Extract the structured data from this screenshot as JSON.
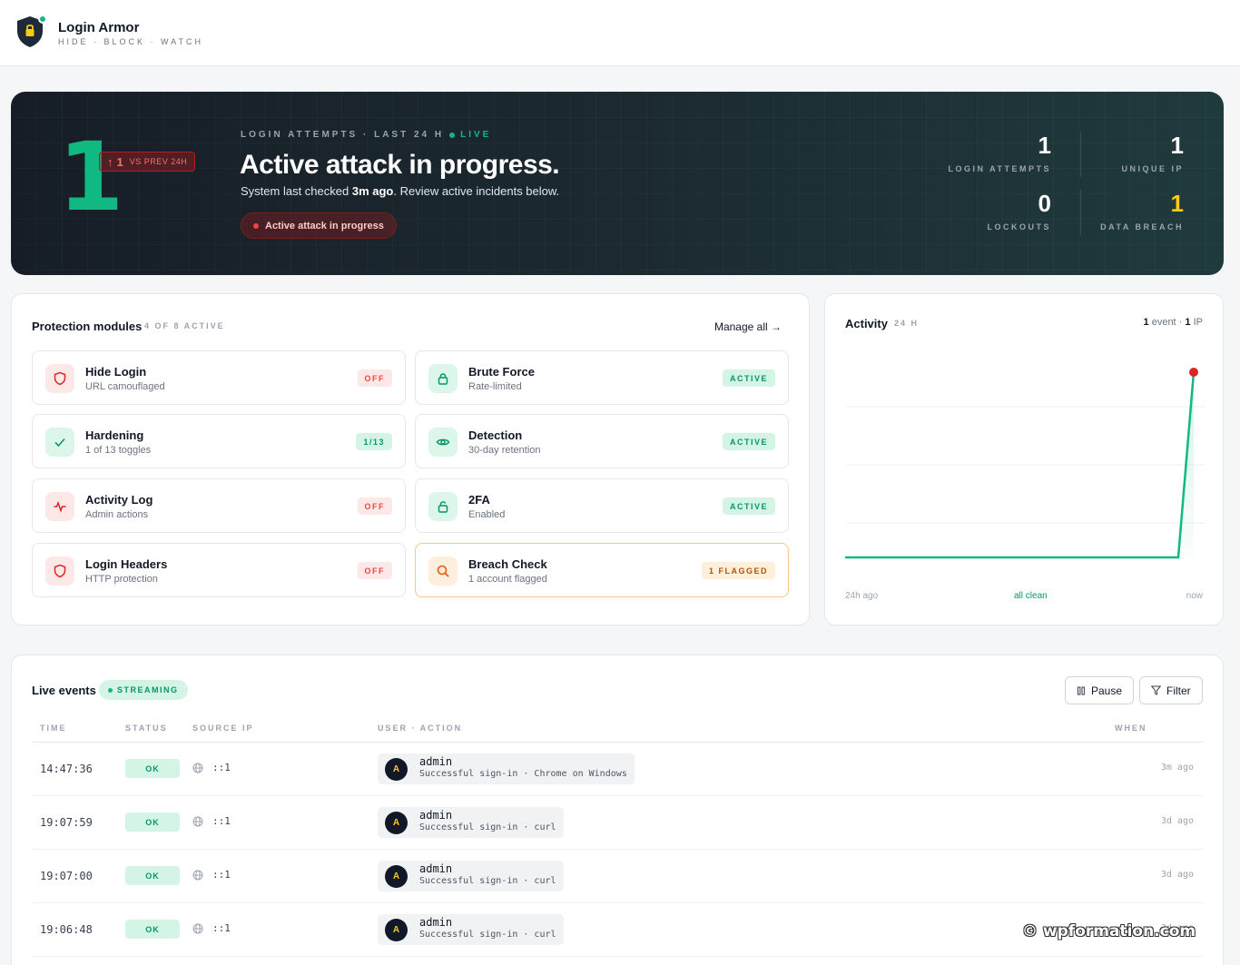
{
  "brand": {
    "name": "Login Armor",
    "tagline": "HIDE · BLOCK · WATCH"
  },
  "hero": {
    "big_number": "1",
    "delta": {
      "arrow": "↑",
      "value": "1",
      "label": "VS PREV 24H"
    },
    "kicker": "LOGIN ATTEMPTS · LAST 24 H",
    "live_label": "LIVE",
    "title": "Active attack in progress.",
    "subtitle_prefix": "System last checked",
    "subtitle_time": "3m ago",
    "subtitle_suffix": ". Review active incidents below.",
    "attack_pill": "Active attack in progress",
    "stats": [
      {
        "value": "1",
        "label": "LOGIN ATTEMPTS"
      },
      {
        "value": "1",
        "label": "UNIQUE IP"
      },
      {
        "value": "0",
        "label": "LOCKOUTS"
      },
      {
        "value": "1",
        "label": "DATA BREACH"
      }
    ]
  },
  "modules": {
    "title": "Protection modules",
    "count_label": "4 OF 8 ACTIVE",
    "manage_label": "Manage all →",
    "items": [
      {
        "title": "Hide Login",
        "sub": "URL camouflaged",
        "badge": "OFF",
        "icon": "shield-icon"
      },
      {
        "title": "Brute Force",
        "sub": "Rate-limited",
        "badge": "ACTIVE",
        "icon": "lock-icon"
      },
      {
        "title": "Hardening",
        "sub": "1 of 13 toggles",
        "badge": "1/13",
        "icon": "check-icon"
      },
      {
        "title": "Detection",
        "sub": "30-day retention",
        "badge": "ACTIVE",
        "icon": "eye-icon"
      },
      {
        "title": "Activity Log",
        "sub": "Admin actions",
        "badge": "OFF",
        "icon": "pulse-icon"
      },
      {
        "title": "2FA",
        "sub": "Enabled",
        "badge": "ACTIVE",
        "icon": "unlock-icon"
      },
      {
        "title": "Login Headers",
        "sub": "HTTP protection",
        "badge": "OFF",
        "icon": "shield-icon"
      },
      {
        "title": "Breach Check",
        "sub": "1 account flagged",
        "badge": "1 FLAGGED",
        "icon": "search-icon"
      }
    ]
  },
  "activity": {
    "title": "Activity",
    "range": "24 H",
    "summary_events": "1",
    "summary_events_label": "event ·",
    "summary_ip": "1",
    "summary_ip_label": "IP",
    "foot_left": "24h ago",
    "foot_mid": "all clean",
    "foot_right": "now"
  },
  "events": {
    "title": "Live events",
    "streaming_label": "STREAMING",
    "pause_label": "Pause",
    "filter_label": "Filter",
    "columns": [
      "TIME",
      "STATUS",
      "SOURCE IP",
      "USER · ACTION",
      "WHEN"
    ],
    "rows": [
      {
        "time": "14:47:36",
        "status": "OK",
        "ip": "::1",
        "avatar": "A",
        "user": "admin",
        "action": "Successful sign-in · Chrome on Windows",
        "when": "3m ago"
      },
      {
        "time": "19:07:59",
        "status": "OK",
        "ip": "::1",
        "avatar": "A",
        "user": "admin",
        "action": "Successful sign-in · curl",
        "when": "3d ago"
      },
      {
        "time": "19:07:00",
        "status": "OK",
        "ip": "::1",
        "avatar": "A",
        "user": "admin",
        "action": "Successful sign-in · curl",
        "when": "3d ago"
      },
      {
        "time": "19:06:48",
        "status": "OK",
        "ip": "::1",
        "avatar": "A",
        "user": "admin",
        "action": "Successful sign-in · curl",
        "when": "3d ago"
      }
    ]
  },
  "watermark": "© wpformation.com",
  "colors": {
    "accent": "#10b981",
    "danger": "#ef4444",
    "warning": "#facc15"
  }
}
